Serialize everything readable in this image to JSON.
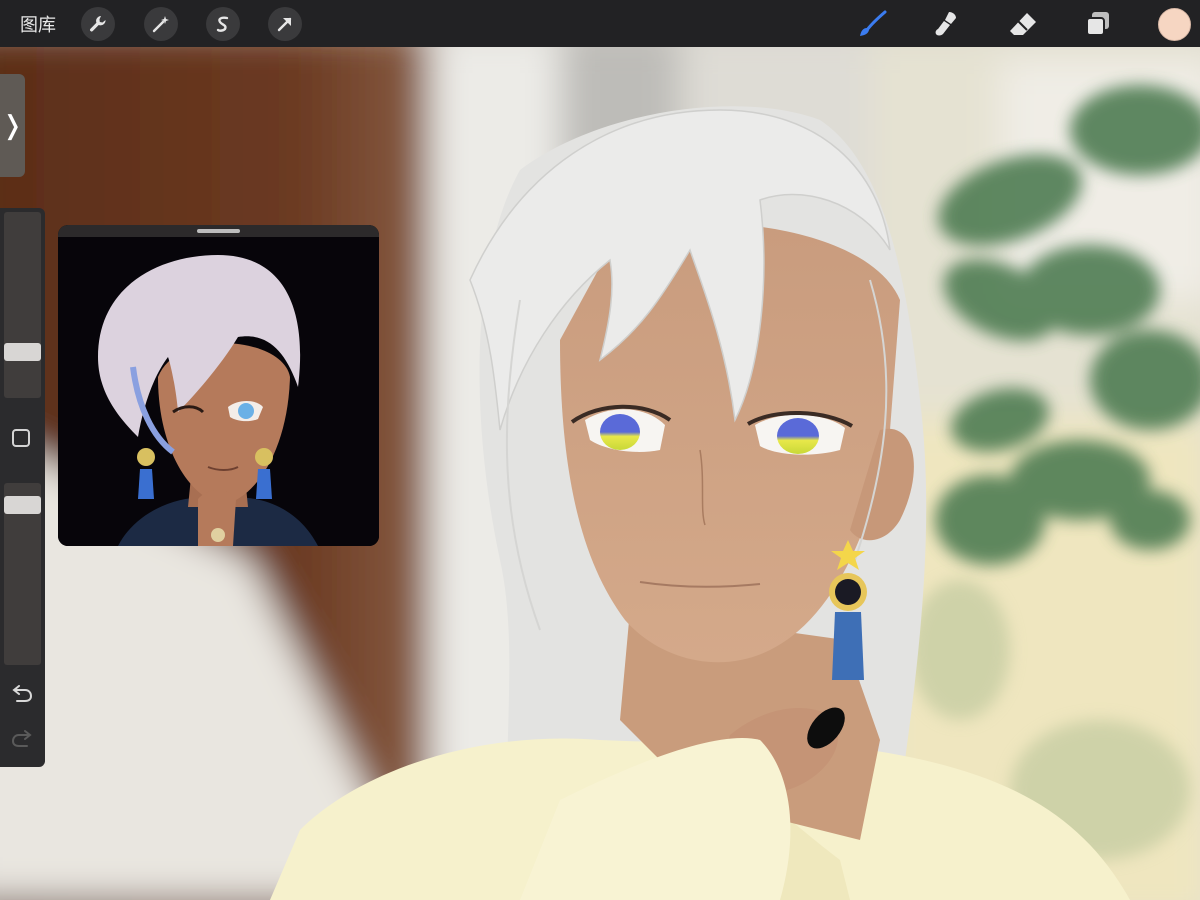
{
  "toolbar": {
    "gallery_label": "图库",
    "left_tools": [
      "wrench-icon",
      "magic-wand-icon",
      "selection-icon",
      "transform-arrow-icon"
    ],
    "right_tools": [
      "brush-icon",
      "smudge-icon",
      "eraser-icon",
      "layers-icon"
    ],
    "active_tool": "brush-icon",
    "active_color": "#f6d6c2"
  },
  "sidebar": {
    "collapse_glyph": "❭",
    "brush_size_level": 0.22,
    "opacity_level": 0.92
  },
  "colors": {
    "accent_blue": "#3b7cf0",
    "toolbar_bg": "#222224"
  }
}
